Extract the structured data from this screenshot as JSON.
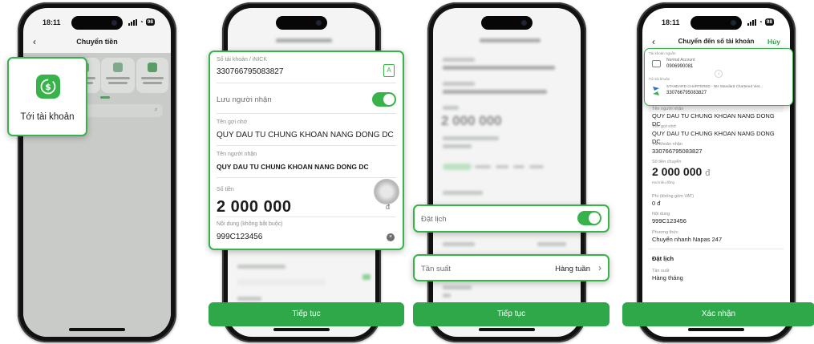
{
  "colors": {
    "accent": "#37b34a",
    "button": "#2fa84a"
  },
  "screen1": {
    "time": "18:11",
    "battery": "98",
    "title": "Chuyển tiền",
    "callout_label": "Tới tài khoản",
    "callout_icon": "money-transfer-icon"
  },
  "screen2": {
    "account_label": "Số tài khoản / iNICK",
    "account_value": "330766795083827",
    "save_label": "Lưu người nhận",
    "nickname_label": "Tên gợi nhớ",
    "nickname_value": "QUY DAU TU CHUNG KHOAN NANG DONG DC",
    "recipient_label": "Tên người nhận",
    "recipient_value": "QUY DAU TU CHUNG KHOAN NANG DONG DC",
    "amount_label": "Số tiền",
    "amount_value": "2 000 000",
    "currency": "đ",
    "content_label": "Nội dung (không bắt buộc)",
    "content_value": "999C123456",
    "continue_label": "Tiếp tục"
  },
  "screen3": {
    "amount_value": "2 000 000",
    "schedule_label": "Đặt lịch",
    "frequency_label": "Tần suất",
    "frequency_value": "Hàng tuần",
    "continue_label": "Tiếp tục"
  },
  "screen4": {
    "time": "18:11",
    "battery": "98",
    "title": "Chuyển đến số tài khoản",
    "cancel_label": "Hủy",
    "source_label": "Tài khoản nguồn",
    "source_name": "Normal Account",
    "source_number": "0906990081",
    "dest_label": "Tới tài khoản",
    "dest_bank": "STANDARD CHARTERED - NH Standard Chartered Viet...",
    "dest_number": "330766795083827",
    "recipient_label": "Tên người nhận",
    "recipient_value": "QUY DAU TU CHUNG KHOAN NANG DONG DC",
    "nickname_label": "Tên gợi nhớ",
    "nickname_value": "QUY DAU TU CHUNG KHOAN NANG DONG DC",
    "account_label": "Tài khoản nhận",
    "account_value": "330766795083827",
    "amount_label": "Số tiền chuyển",
    "amount_value": "2 000 000",
    "currency": "đ",
    "amount_words": "Hai triệu đồng",
    "fee_label": "Phí (không gồm VAT)",
    "fee_value": "0 đ",
    "content_label": "Nội dung",
    "content_value": "999C123456",
    "method_label": "Phương thức",
    "method_value": "Chuyển nhanh Napas 247",
    "schedule_header": "Đặt lịch",
    "frequency_label": "Tần suất",
    "frequency_value": "Hàng tháng",
    "confirm_label": "Xác nhận"
  }
}
